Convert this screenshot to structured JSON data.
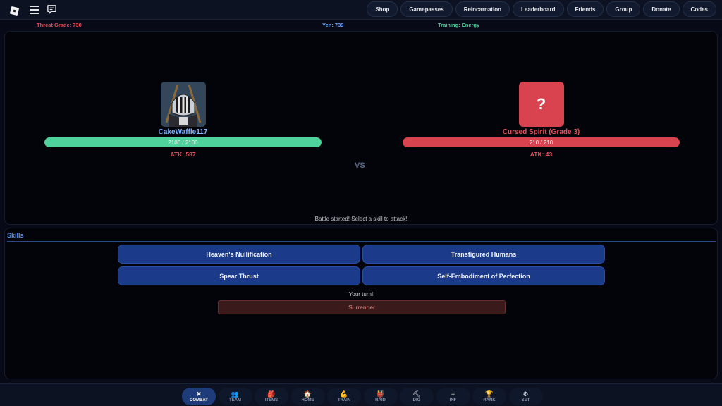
{
  "topbar": {
    "nav": [
      "Shop",
      "Gamepasses",
      "Reincarnation",
      "Leaderboard",
      "Friends",
      "Group",
      "Donate",
      "Codes"
    ]
  },
  "status": {
    "threat": "Threat Grade: 730",
    "yen": "Yen: 739",
    "training": "Training: Energy"
  },
  "battle": {
    "player": {
      "name": "CakeWaffle117",
      "hp_text": "2100 / 2100",
      "hp_fraction": 1.0,
      "atk": "ATK: 587"
    },
    "enemy": {
      "avatar_symbol": "?",
      "name": "Cursed Spirit (Grade 3)",
      "hp_text": "210 / 210",
      "hp_fraction": 1.0,
      "atk": "ATK: 43"
    },
    "vs": "VS",
    "message": "Battle started! Select a skill to attack!"
  },
  "skills": {
    "title": "Skills",
    "buttons": [
      "Heaven's Nullification",
      "Transfigured Humans",
      "Spear Thrust",
      "Self-Embodiment of Perfection"
    ],
    "turn": "Your turn!",
    "surrender": "Surrender"
  },
  "bottomnav": {
    "items": [
      {
        "label": "COMBAT",
        "icon": "✖",
        "icon_name": "crossed-swords-icon"
      },
      {
        "label": "TEAM",
        "icon": "👥",
        "icon_name": "team-icon"
      },
      {
        "label": "ITEMS",
        "icon": "🎒",
        "icon_name": "backpack-icon"
      },
      {
        "label": "HOME",
        "icon": "🏠",
        "icon_name": "home-icon"
      },
      {
        "label": "TRAIN",
        "icon": "💪",
        "icon_name": "muscle-icon"
      },
      {
        "label": "RAID",
        "icon": "👹",
        "icon_name": "demon-icon"
      },
      {
        "label": "DIG",
        "icon": "⛏",
        "icon_name": "pickaxe-icon"
      },
      {
        "label": "INF",
        "icon": "≡",
        "icon_name": "info-icon"
      },
      {
        "label": "RANK",
        "icon": "🏆",
        "icon_name": "trophy-icon"
      },
      {
        "label": "SET",
        "icon": "⚙",
        "icon_name": "gear-icon"
      }
    ],
    "active": "COMBAT"
  },
  "colors": {
    "player_hp": "#4fd39c",
    "enemy_hp": "#d9434f",
    "skill_button": "#1b3b8a",
    "accent_blue": "#5b8fe6"
  }
}
